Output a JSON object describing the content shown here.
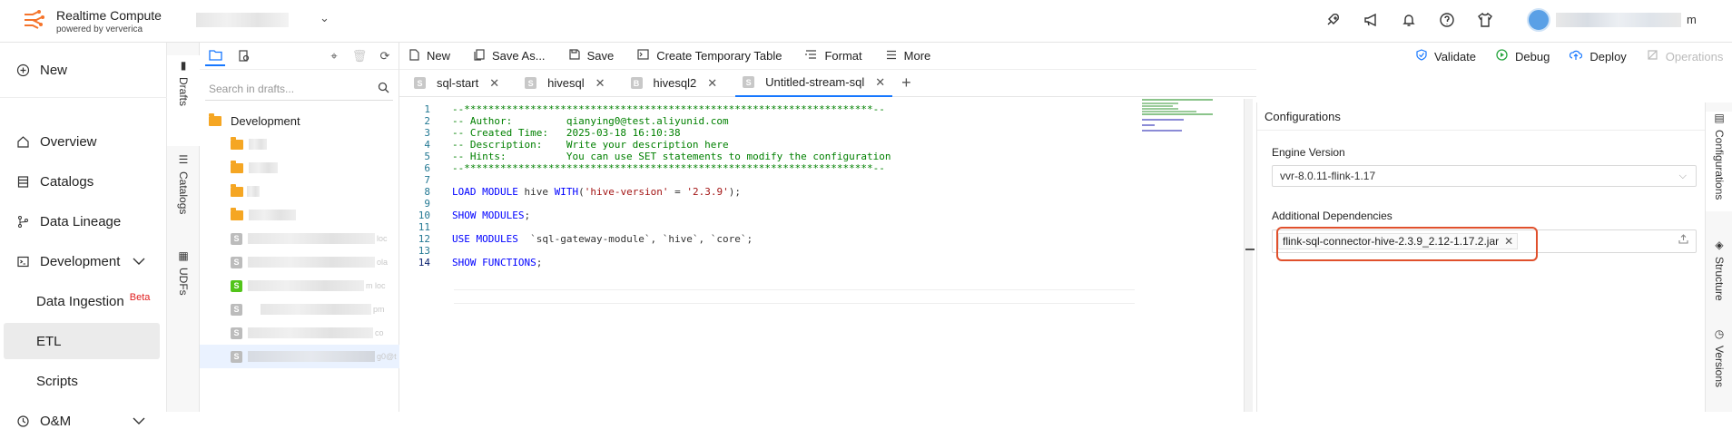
{
  "header": {
    "brand_title": "Realtime Compute",
    "brand_sub": "powered by ververica",
    "user_suffix": "m",
    "icons": [
      "rocket-icon",
      "megaphone-icon",
      "bell-icon",
      "help-icon",
      "shirt-icon"
    ]
  },
  "leftnav": {
    "new_label": "New",
    "items": [
      {
        "label": "Overview",
        "icon": "home-icon"
      },
      {
        "label": "Catalogs",
        "icon": "catalog-icon"
      },
      {
        "label": "Data Lineage",
        "icon": "lineage-icon"
      },
      {
        "label": "Development",
        "icon": "terminal-icon"
      },
      {
        "label": "Data Ingestion",
        "beta": "Beta"
      },
      {
        "label": "ETL"
      },
      {
        "label": "Scripts"
      },
      {
        "label": "O&M",
        "icon": "om-icon"
      }
    ]
  },
  "vtabs": {
    "drafts": "Drafts",
    "catalogs": "Catalogs",
    "udfs": "UDFs"
  },
  "explorer": {
    "search_placeholder": "Search in drafts...",
    "root_folder": "Development",
    "faint_suffixes": [
      "loc",
      "ola",
      "m loc",
      "pm",
      "co",
      "g0@t"
    ]
  },
  "editor": {
    "toolbar": {
      "new": "New",
      "save_as": "Save As...",
      "save": "Save",
      "create_temp_table": "Create Temporary Table",
      "format": "Format",
      "more": "More"
    },
    "run": {
      "validate": "Validate",
      "debug": "Debug",
      "deploy": "Deploy",
      "operations": "Operations"
    },
    "tabs": [
      {
        "badge": "S",
        "label": "sql-start"
      },
      {
        "badge": "S",
        "label": "hivesql"
      },
      {
        "badge": "B",
        "label": "hivesql2"
      },
      {
        "badge": "S",
        "label": "Untitled-stream-sql"
      }
    ],
    "lines": [
      {
        "n": "1",
        "t": "--********************************************************************--"
      },
      {
        "n": "2",
        "t": "-- Author:         qianying0@test.aliyunid.com"
      },
      {
        "n": "3",
        "t": "-- Created Time:   2025-03-18 16:10:38"
      },
      {
        "n": "4",
        "t": "-- Description:    Write your description here"
      },
      {
        "n": "5",
        "t": "-- Hints:          You can use SET statements to modify the configuration"
      },
      {
        "n": "6",
        "t": "--********************************************************************--"
      },
      {
        "n": "7",
        "t": ""
      },
      {
        "n": "8",
        "t": "LOAD MODULE hive WITH('hive-version' = '2.3.9');"
      },
      {
        "n": "9",
        "t": ""
      },
      {
        "n": "10",
        "t": "SHOW MODULES;"
      },
      {
        "n": "11",
        "t": ""
      },
      {
        "n": "12",
        "t": "USE MODULES  `sql-gateway-module`, `hive`, `core`;"
      },
      {
        "n": "13",
        "t": ""
      },
      {
        "n": "14",
        "t": "SHOW FUNCTIONS;"
      }
    ]
  },
  "config": {
    "title": "Configurations",
    "engine_label": "Engine Version",
    "engine_value": "vvr-8.0.11-flink-1.17",
    "deps_label": "Additional Dependencies",
    "dep_tag": "flink-sql-connector-hive-2.3.9_2.12-1.17.2.jar"
  },
  "rightbar": {
    "configurations": "Configurations",
    "structure": "Structure",
    "versions": "Versions"
  },
  "colors": {
    "accent": "#1677ff",
    "highlight": "#e0502c",
    "folder": "#f5a623",
    "comment": "#008000",
    "keyword": "#0000ff",
    "string": "#a31515"
  }
}
